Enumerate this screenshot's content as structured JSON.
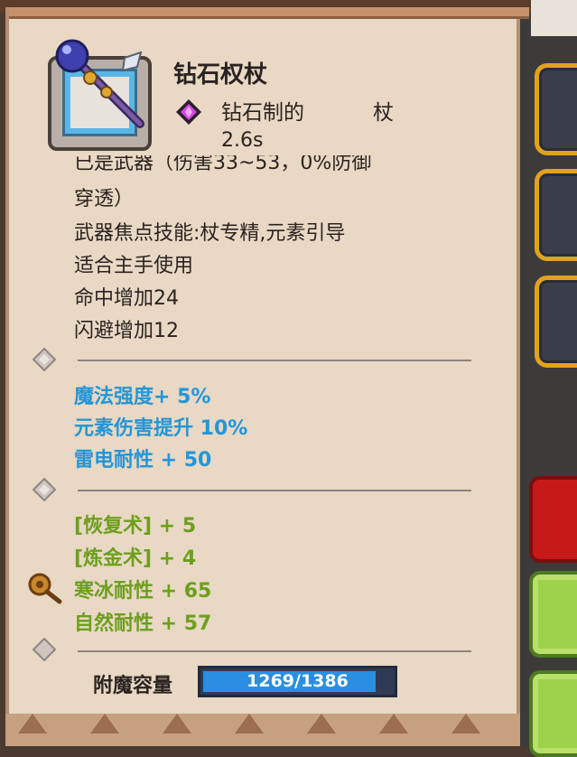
{
  "item": {
    "name": "钻石权杖",
    "material_label": "钻石制的",
    "type_label": "杖",
    "attack_speed": "2.6s",
    "description_lines": [
      "已是武器（伤害33~53，0%防御",
      "穿透）",
      "武器焦点技能:杖专精,元素引导",
      "适合主手使用",
      "命中增加24",
      "闪避增加12"
    ]
  },
  "magic_stats": [
    "魔法强度+ 5%",
    "元素伤害提升 10%",
    "雷电耐性 + 50"
  ],
  "bonus_stats": [
    "[恢复术] + 5",
    "[炼金术] + 4",
    "寒冰耐性 + 65",
    "自然耐性 + 57"
  ],
  "enchant": {
    "label": "附魔容量",
    "current": 1269,
    "max": 1386,
    "text": "1269/1386"
  },
  "colors": {
    "parchment": "#e8d8c4",
    "magic_text": "#2396d8",
    "bonus_text": "#6d9f1e",
    "bar_fill": "#2a8fe0"
  },
  "icons": {
    "item_icon": "diamond-staff-icon",
    "material_icon": "purple-gem-icon",
    "socket_icon": "diamond-socket-icon",
    "charm_icon": "amulet-icon"
  }
}
